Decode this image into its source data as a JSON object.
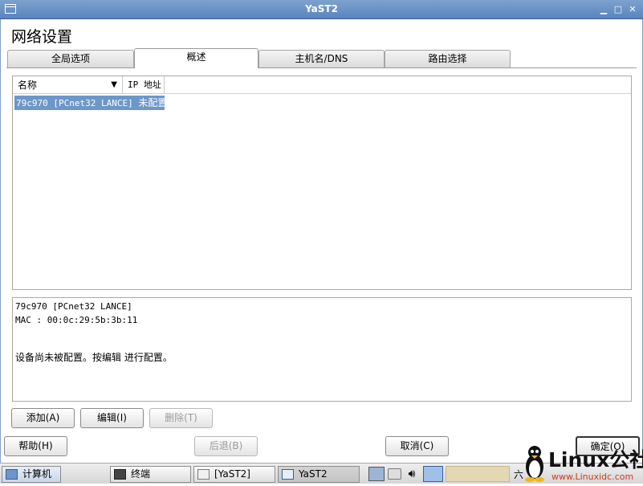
{
  "window": {
    "title": "YaST2",
    "minimize": "▁",
    "maximize": "□",
    "close": "✕"
  },
  "heading": "网络设置",
  "tabs": [
    {
      "label": "全局选项"
    },
    {
      "label": "概述"
    },
    {
      "label": "主机名/DNS"
    },
    {
      "label": "路由选择"
    }
  ],
  "list": {
    "columns": [
      "名称",
      "IP 地址"
    ],
    "rows": [
      {
        "name": "79c970 [PCnet32 LANCE]",
        "status": "未配置"
      }
    ]
  },
  "details": {
    "device": "79c970 [PCnet32 LANCE]",
    "mac": "MAC : 00:0c:29:5b:3b:11",
    "message": "设备尚未被配置。按编辑 进行配置。"
  },
  "buttons": {
    "add": "添加(A)",
    "edit": "编辑(I)",
    "delete": "删除(T)",
    "help": "帮助(H)",
    "back": "后退(B)",
    "cancel": "取消(C)",
    "ok": "确定(O)"
  },
  "taskbar": {
    "computer": "计算机",
    "terminal": "终端",
    "yast_bracket": "[YaST2]",
    "yast": "YaST2",
    "clock_fragment": "六"
  },
  "watermark": {
    "brand": "Linux公社",
    "url": "www.Linuxidc.com"
  },
  "colors": {
    "titlebar": "#5a84bd",
    "selection": "#6d97c9"
  }
}
